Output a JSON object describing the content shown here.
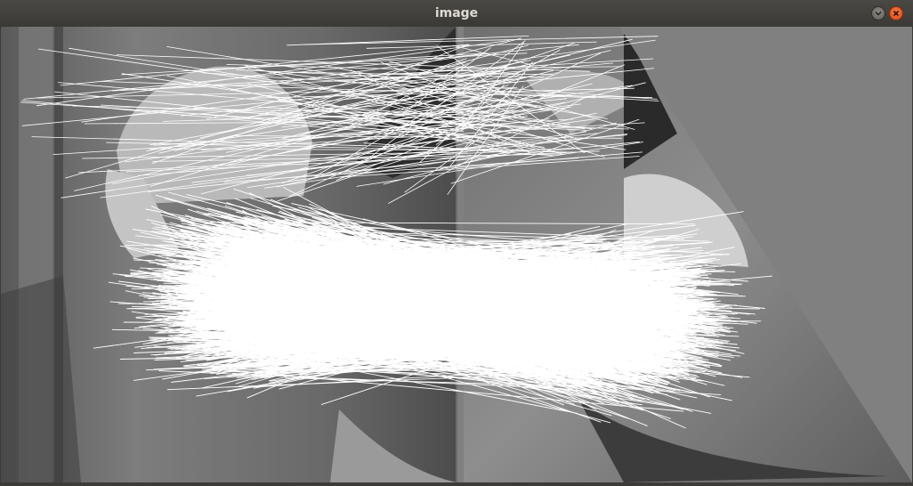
{
  "window": {
    "title": "image",
    "controls": [
      {
        "name": "minimize-button",
        "icon": "chevron-down-icon"
      },
      {
        "name": "close-button",
        "icon": "close-icon"
      }
    ]
  },
  "colors": {
    "titlebar": "#3c3b37",
    "title_text": "#dfdbd2",
    "close_accent": "#e95420",
    "canvas_gray": "#808080",
    "match_lines": "#ffffff"
  }
}
